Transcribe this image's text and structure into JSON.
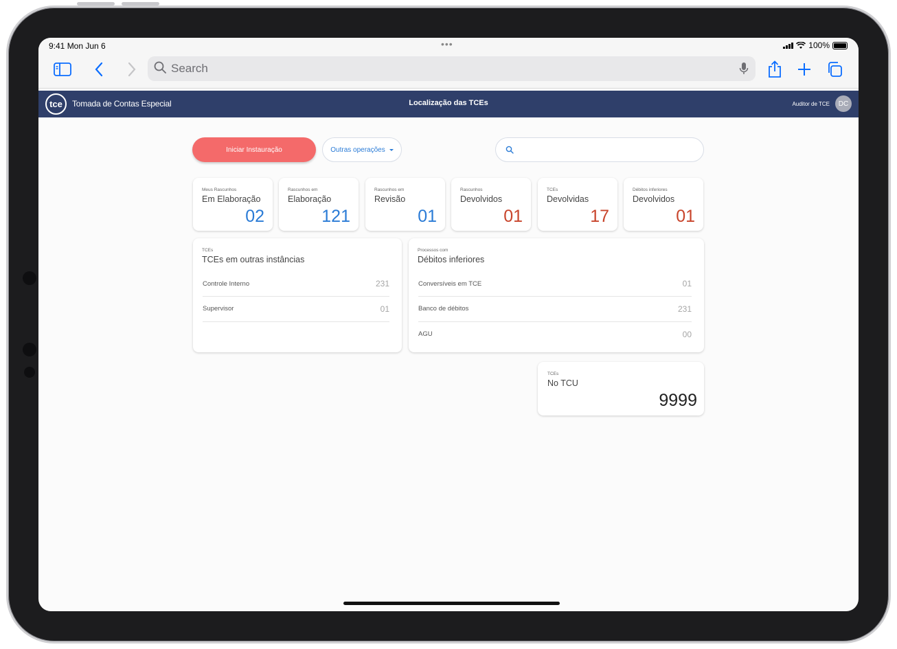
{
  "status_bar": {
    "time": "9:41  Mon Jun 6",
    "battery": "100%"
  },
  "safari": {
    "search_placeholder": "Search"
  },
  "app": {
    "logo": "tce",
    "title": "Tomada de Contas Especial",
    "page_title": "Localização das TCEs",
    "user_role": "Auditor de TCE",
    "user_initials": "DC"
  },
  "actions": {
    "primary": "Iniciar Instauração",
    "more": "Outras operações"
  },
  "stats": [
    {
      "caption": "Meus Rascunhos",
      "label": "Em Elaboração",
      "value": "02",
      "color": "blue"
    },
    {
      "caption": "Rascunhos em",
      "label": "Elaboração",
      "value": "121",
      "color": "blue"
    },
    {
      "caption": "Rascunhos em",
      "label": "Revisão",
      "value": "01",
      "color": "blue"
    },
    {
      "caption": "Rascunhos",
      "label": "Devolvidos",
      "value": "01",
      "color": "red"
    },
    {
      "caption": "TCEs",
      "label": "Devolvidas",
      "value": "17",
      "color": "red"
    },
    {
      "caption": "Débitos inferiores",
      "label": "Devolvidos",
      "value": "01",
      "color": "red"
    }
  ],
  "instances": {
    "caption": "TCEs",
    "label": "TCEs em outras instâncias",
    "rows": [
      {
        "name": "Controle Interno",
        "value": "231"
      },
      {
        "name": "Supervisor",
        "value": "01"
      }
    ]
  },
  "debts": {
    "caption": "Processos com",
    "label": "Débitos inferiores",
    "rows": [
      {
        "name": "Conversíveis em TCE",
        "value": "01"
      },
      {
        "name": "Banco de débitos",
        "value": "231"
      },
      {
        "name": "AGU",
        "value": "00"
      }
    ]
  },
  "tcu": {
    "caption": "TCEs",
    "label": "No TCU",
    "value": "9999"
  },
  "colors": {
    "header": "#2f3f6a",
    "primary": "#f46a6a",
    "blue": "#2a7bd6",
    "red": "#c8442b"
  }
}
